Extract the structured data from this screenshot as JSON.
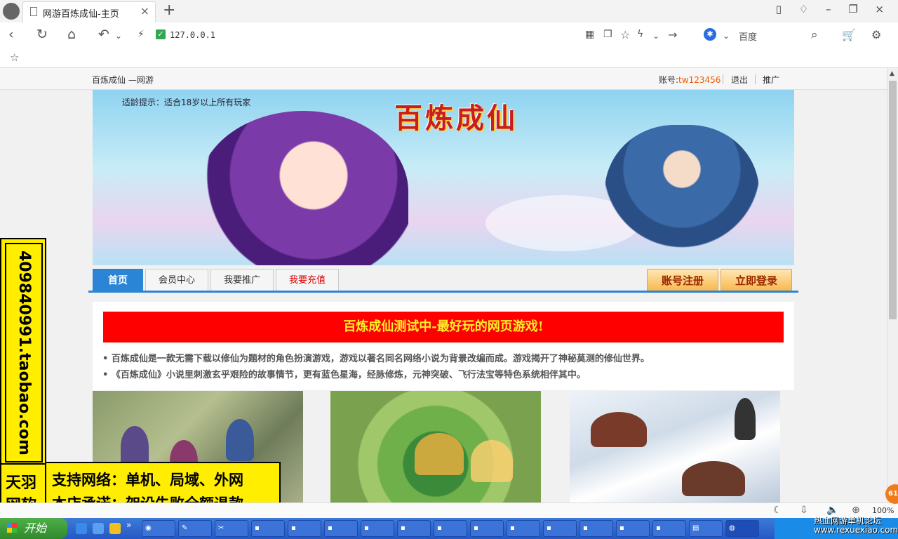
{
  "browser": {
    "tab_title": "网游百炼成仙-主页",
    "address": "127.0.0.1",
    "search_engine": "百度",
    "zoom": "100%"
  },
  "site": {
    "name": "百炼成仙 —网游",
    "account_label": "账号:",
    "account_user": "tw123456",
    "logout": "退出",
    "promote": "推广",
    "age_notice": "适龄提示：适合18岁以上所有玩家",
    "logo_text": "百炼成仙",
    "nav": {
      "home": "首页",
      "member": "会员中心",
      "promo": "我要推广",
      "recharge": "我要充值"
    },
    "register": "账号注册",
    "login": "立即登录",
    "headline": "百炼成仙测试中-最好玩的网页游戏!",
    "desc": [
      "• 百炼成仙是一款无需下载以修仙为题材的角色扮演游戏，游戏以著名同名网络小说为背景改编而成。游戏揭开了神秘莫测的修仙世界。",
      "• 《百炼成仙》小说里刺激玄乎艰险的故事情节，更有蓝色星海，经脉修炼，元神突破、飞行法宝等特色系统相伴其中。"
    ]
  },
  "ad": {
    "url": "409840991.taobao.com",
    "brand1": "天羽",
    "brand2": "网软",
    "line1": "支持网络：单机、局域、外网",
    "line2": "本店承诺：架设失败全额退款"
  },
  "taskbar": {
    "start": "开始",
    "tray_line1": "热血网游单机论坛",
    "tray_line2": "www.rexuexiao.com",
    "bubble": "61"
  }
}
